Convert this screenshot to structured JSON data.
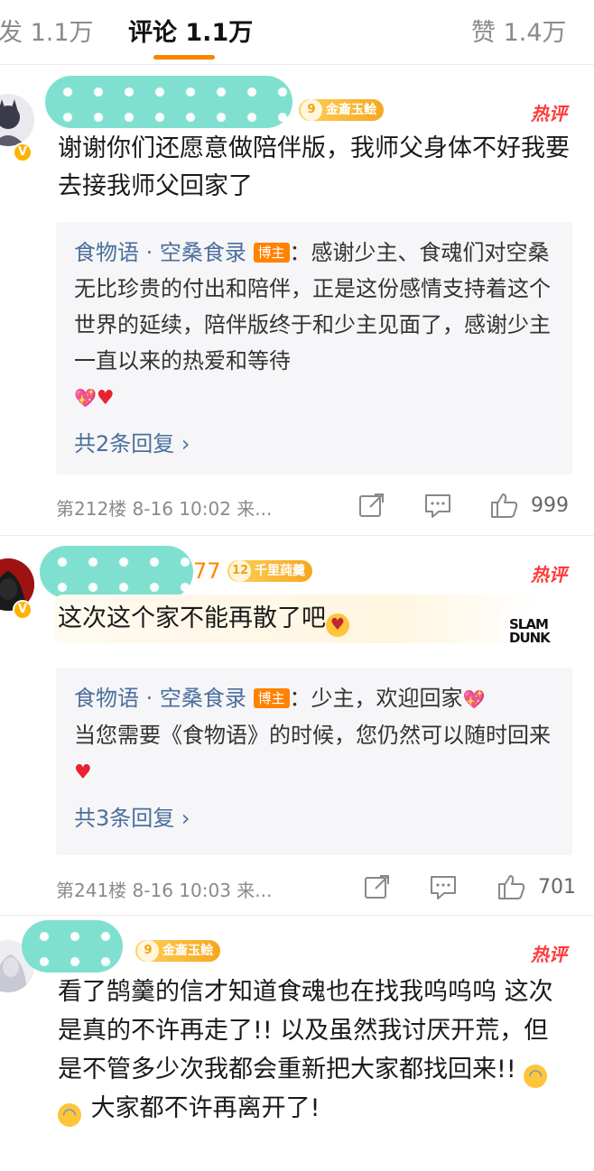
{
  "tabs": {
    "repost": "发 1.1万",
    "comment": "评论 1.1万",
    "like": "赞 1.4万"
  },
  "colors": {
    "accent": "#ff8200",
    "hot": "#ff3a3a",
    "link": "#4a6f9c"
  },
  "comments": [
    {
      "name_suffix": "",
      "badge_level": "9",
      "badge_text": "金齑玉鲙",
      "hot_label": "热评",
      "text": "谢谢你们还愿意做陪伴版，我师父身体不好我要去接我师父回家了",
      "reply": {
        "author": "食物语 · 空桑食录",
        "tag": "博主",
        "text": "：感谢少主、食魂们对空桑无比珍贵的付出和陪伴，正是这份感情支持着这个世界的延续，陪伴版终于和少主见面了，感谢少主一直以来的热爱和等待",
        "more": "共2条回复 ›"
      },
      "meta": "第212楼 8-16 10:02 来...",
      "likes": "999"
    },
    {
      "name_suffix": "77",
      "badge_level": "12",
      "badge_text": "千里莼羹",
      "hot_label": "热评",
      "text": "这次这个家不能再散了吧",
      "card_brand": "SLAM DUNK",
      "reply": {
        "author": "食物语 · 空桑食录",
        "tag": "博主",
        "text": "：少主，欢迎回家",
        "text2": "当您需要《食物语》的时候，您仍然可以随时回来",
        "more": "共3条回复 ›"
      },
      "meta": "第241楼 8-16 10:03 来...",
      "likes": "701"
    },
    {
      "name_suffix": "",
      "badge_level": "9",
      "badge_text": "金齑玉鲙",
      "hot_label": "热评",
      "text_a": "看了鹄羹的信才知道食魂也在找我呜呜呜 这次是真的不许再走了!! 以及虽然我讨厌开荒，但是不管多少次我都会重新把大家都找回来!! ",
      "text_b": " 大家都不许再离开了!"
    }
  ]
}
